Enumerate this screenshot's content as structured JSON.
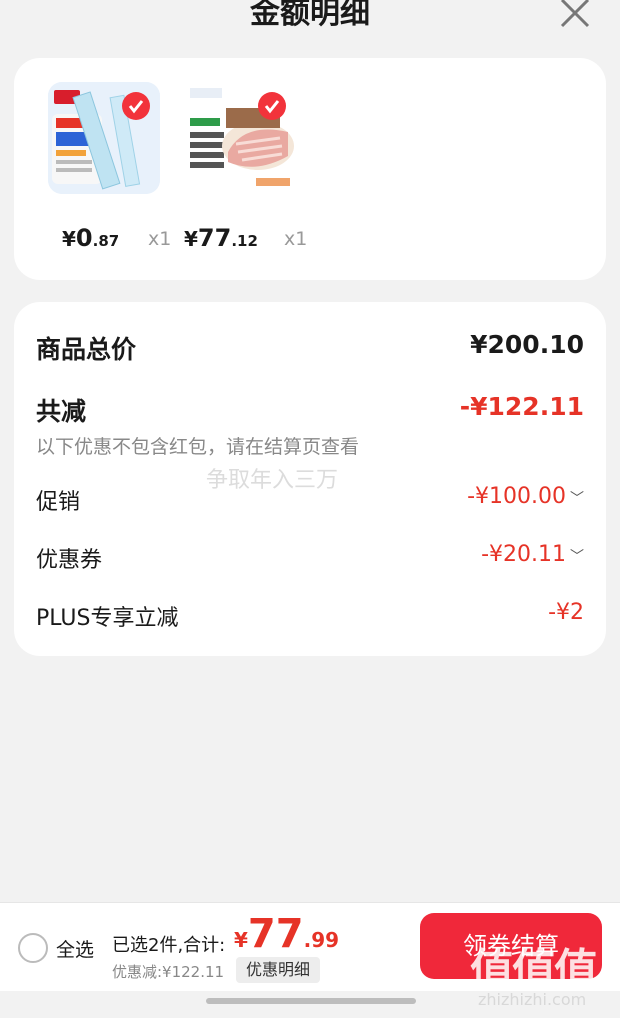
{
  "header": {
    "title": "金额明细"
  },
  "products": [
    {
      "price_symbol": "¥",
      "price_int": "0",
      "price_dec": ".87",
      "qty": "x1",
      "thumb_icon": "ruler-product-image"
    },
    {
      "price_symbol": "¥",
      "price_int": "77",
      "price_dec": ".12",
      "qty": "x1",
      "thumb_icon": "pork-ribs-product-image"
    }
  ],
  "summary": {
    "total_label": "商品总价",
    "total_value": "¥200.10",
    "reduce_label": "共减",
    "reduce_value": "-¥122.11",
    "note": "以下优惠不包含红包，请在结算页查看",
    "promo_label": "促销",
    "promo_value": "-¥100.00",
    "coupon_label": "优惠券",
    "coupon_value": "-¥20.11",
    "plus_label": "PLUS专享立减",
    "plus_value": "-¥2"
  },
  "watermark": "争取年入三万",
  "bottom": {
    "select_all": "全选",
    "selected_info": "已选2件,合计:",
    "total_symbol": "¥",
    "total_int": "77",
    "total_dec": ".99",
    "discount_text": "优惠减:¥122.11",
    "detail_button": "优惠明细",
    "checkout_button": "领券结算"
  },
  "brand": {
    "mark": "值值值",
    "url": "zhizhizhi.com"
  },
  "colors": {
    "accent": "#e63327",
    "checkout": "#f0283a"
  }
}
